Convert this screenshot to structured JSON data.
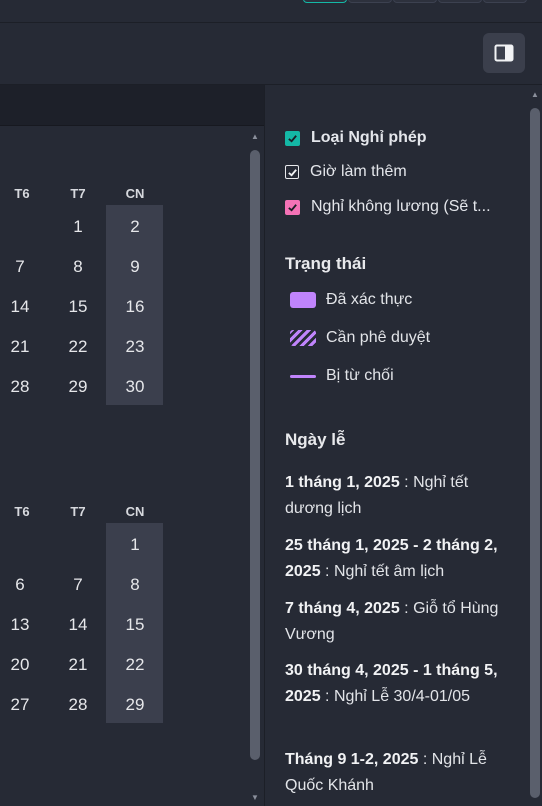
{
  "calendar": {
    "month1": {
      "weekdays": [
        "T6",
        "T7",
        "CN"
      ],
      "rows": [
        [
          "",
          "1",
          "2"
        ],
        [
          "7",
          "8",
          "9"
        ],
        [
          "14",
          "15",
          "16"
        ],
        [
          "21",
          "22",
          "23"
        ],
        [
          "28",
          "29",
          "30"
        ]
      ]
    },
    "month2": {
      "weekdays": [
        "T6",
        "T7",
        "CN"
      ],
      "rows": [
        [
          "",
          "",
          "1"
        ],
        [
          "6",
          "7",
          "8"
        ],
        [
          "13",
          "14",
          "15"
        ],
        [
          "20",
          "21",
          "22"
        ],
        [
          "27",
          "28",
          "29"
        ]
      ]
    }
  },
  "filters": [
    {
      "label": "Loại Nghỉ phép",
      "checked": true,
      "color": "#14b8a6",
      "bold": true
    },
    {
      "label": "Giờ làm thêm",
      "checked": true,
      "color": "#262a35",
      "bold": false
    },
    {
      "label": "Nghỉ không lương (Sẽ t...",
      "checked": true,
      "color": "#f472b6",
      "bold": false
    }
  ],
  "status": {
    "title": "Trạng thái",
    "items": [
      {
        "label": "Đã xác thực",
        "style": "solid",
        "color": "#c084fc"
      },
      {
        "label": "Cần phê duyệt",
        "style": "striped",
        "color": "#c084fc"
      },
      {
        "label": "Bị từ chối",
        "style": "line",
        "color": "#c084fc"
      }
    ]
  },
  "holidays": {
    "title": "Ngày lễ",
    "items": [
      {
        "date": "1 tháng 1, 2025",
        "name": "Nghỉ tết dương lịch"
      },
      {
        "date": "25 tháng 1, 2025 - 2 tháng 2, 2025",
        "name": "Nghỉ tết âm lịch"
      },
      {
        "date": "7 tháng 4, 2025",
        "name": "Giỗ tổ Hùng Vương"
      },
      {
        "date": "30 tháng 4, 2025 - 1 tháng 5, 2025",
        "name": "Nghỉ Lễ 30/4-01/05"
      },
      {
        "date": "Tháng 9 1-2, 2025",
        "name": "Nghỉ Lễ Quốc Khánh"
      }
    ]
  },
  "icons": {
    "panel_toggle": "sidebar-panel-icon",
    "scroll_up": "chevron-up-icon",
    "scroll_down": "chevron-down-icon"
  }
}
